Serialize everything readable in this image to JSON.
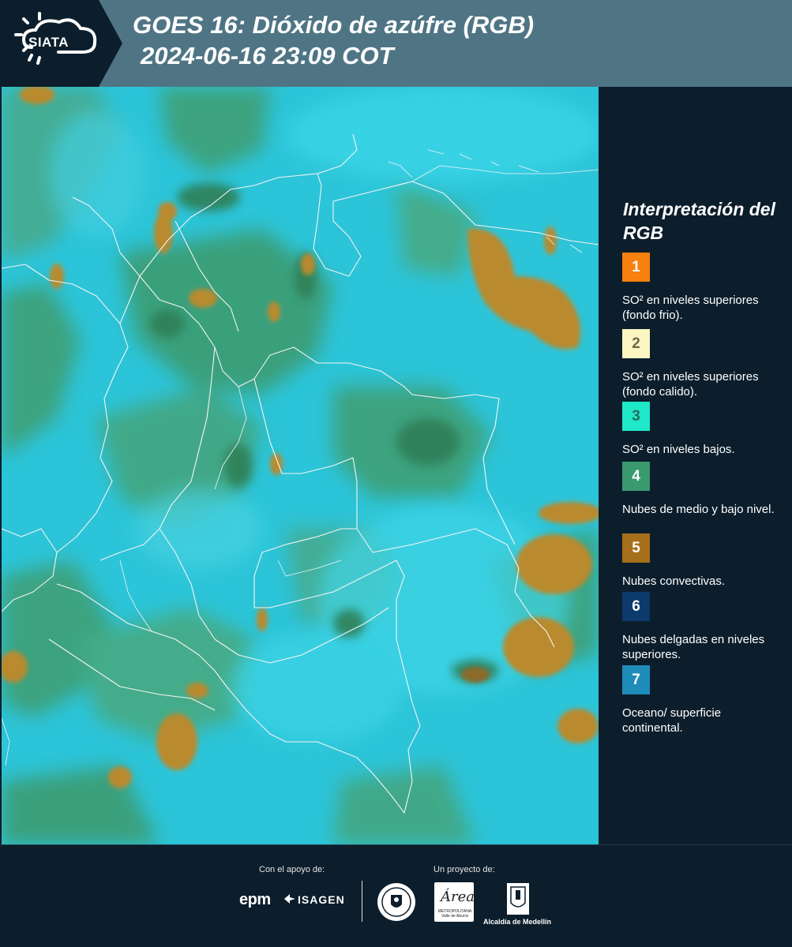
{
  "header": {
    "logo_text": "SIATA",
    "title_line1": "GOES 16: Dióxido de azúfre (RGB)",
    "title_line2": "2024-06-16 23:09 COT"
  },
  "map": {
    "description_icon": "satellite-rgb-map",
    "colors": {
      "background": "#29c6d8",
      "green": "#3e9a6c",
      "dark_green": "#2f7f57",
      "convective": "#b98a2e"
    }
  },
  "legend": {
    "title": "Interpretación del RGB",
    "items": [
      {
        "number": "1",
        "color": "#f7800f",
        "text_color": "#ffffff",
        "label": "SO² en niveles superiores (fondo frio)."
      },
      {
        "number": "2",
        "color": "#fcf6c2",
        "text_color": "#6a6a4a",
        "label": "SO² en niveles superiores (fondo calido)."
      },
      {
        "number": "3",
        "color": "#1ee8c8",
        "text_color": "#2a6b60",
        "label": "SO² en niveles bajos."
      },
      {
        "number": "4",
        "color": "#3a9a6e",
        "text_color": "#ffffff",
        "label": "Nubes de medio y bajo nivel."
      },
      {
        "number": "5",
        "color": "#a66f1b",
        "text_color": "#ffffff",
        "label": "Nubes convectivas."
      },
      {
        "number": "6",
        "color": "#0c3a6c",
        "text_color": "#ffffff",
        "label": "Nubes delgadas en niveles superiores."
      },
      {
        "number": "7",
        "color": "#1e8cb8",
        "text_color": "#ffffff",
        "label": "Oceano/ superficie continental."
      }
    ]
  },
  "footer": {
    "support_label": "Con el apoyo de:",
    "project_label": "Un proyecto de:",
    "epm": "epm",
    "isagen": "ISAGEN",
    "area_script": "Área",
    "area_small": "METROPOLITANA Valle de Aburrá",
    "alcaldia": "Alcaldía de Medellín"
  }
}
